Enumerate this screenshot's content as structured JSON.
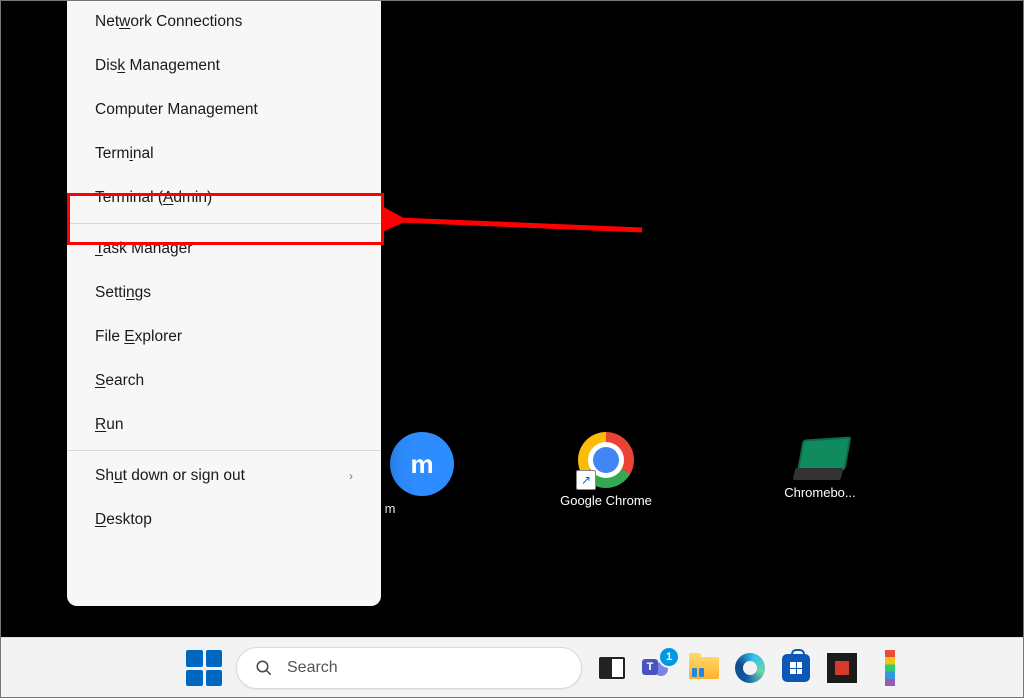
{
  "menu": {
    "items": [
      {
        "pre": "Net",
        "u": "w",
        "post": "ork Connections"
      },
      {
        "pre": "Dis",
        "u": "k",
        "post": " Management"
      },
      {
        "pre": "Computer Mana",
        "u": "g",
        "post": "ement"
      },
      {
        "pre": "Term",
        "u": "i",
        "post": "nal"
      },
      {
        "pre": "Terminal (",
        "u": "A",
        "post": "dmin)",
        "highlighted": true
      },
      {
        "sep": true
      },
      {
        "pre": "",
        "u": "T",
        "post": "ask Manager"
      },
      {
        "pre": "Setti",
        "u": "n",
        "post": "gs"
      },
      {
        "pre": "File ",
        "u": "E",
        "post": "xplorer"
      },
      {
        "pre": "",
        "u": "S",
        "post": "earch"
      },
      {
        "pre": "",
        "u": "R",
        "post": "un"
      },
      {
        "sep": true
      },
      {
        "pre": "Sh",
        "u": "u",
        "post": "t down or sign out",
        "submenu": true
      },
      {
        "pre": "",
        "u": "D",
        "post": "esktop"
      }
    ]
  },
  "desktop_icons": {
    "zoom": {
      "label_suffix": "m"
    },
    "chrome": {
      "label": "Google Chrome"
    },
    "chromebook": {
      "label": "Chromebo..."
    }
  },
  "taskbar": {
    "search_placeholder": "Search",
    "teams_badge": "1"
  }
}
